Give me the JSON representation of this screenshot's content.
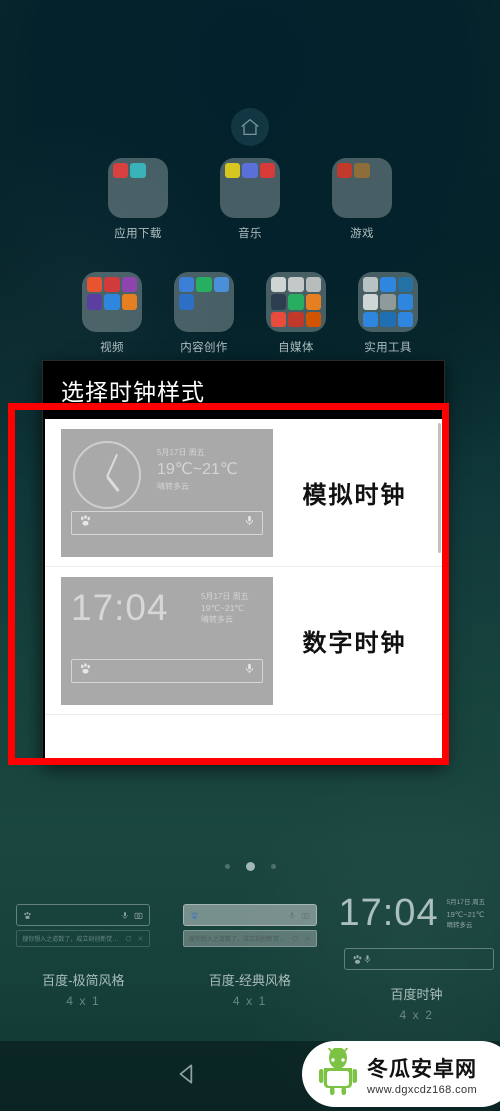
{
  "home": {
    "home_icon": "home-icon",
    "folder_rows": [
      [
        {
          "label": "应用下载",
          "colors": [
            "#d94040",
            "#39b3b8"
          ]
        },
        {
          "label": "音乐",
          "colors": [
            "#d7c520",
            "#5b6fd8",
            "#d83a3a"
          ]
        },
        {
          "label": "游戏",
          "colors": [
            "#c0392b",
            "#8d6e3a"
          ]
        }
      ],
      [
        {
          "label": "视频",
          "colors": [
            "#e8542f",
            "#d23b3b",
            "#8e44ad",
            "#5b3fa0",
            "#2e86de",
            "#e67e22"
          ]
        },
        {
          "label": "内容创作",
          "colors": [
            "#3b7fd6",
            "#27ae60",
            "#4a90d9",
            "#2d6fc4"
          ]
        },
        {
          "label": "自媒体",
          "colors": [
            "#bdc3c7",
            "#95a5a6",
            "#7f8c8d",
            "#2c3e50",
            "#27ae60",
            "#e67e22",
            "#e74c3c",
            "#c0392b",
            "#d35400"
          ]
        },
        {
          "label": "实用工具",
          "colors": [
            "#95a5a6",
            "#2e86de",
            "#2471a3",
            "#bdc3c7",
            "#7f8c8d",
            "#2e86de",
            "#2e86de",
            "#1f6fb2",
            "#2e86de"
          ]
        }
      ]
    ],
    "page_dots": {
      "count": 3,
      "active_index": 1
    }
  },
  "dialog": {
    "title": "选择时钟样式",
    "options": [
      {
        "name": "模拟时钟",
        "preview_type": "analog",
        "date": "5月17日 周五",
        "temperature": "19℃~21℃",
        "weather": "晴转多云",
        "search_left_icon": "baidu-paw-icon",
        "search_right_icon": "microphone-icon"
      },
      {
        "name": "数字时钟",
        "preview_type": "digital",
        "time": "17:04",
        "date": "5月17日 周五",
        "temperature": "19℃~21℃",
        "weather": "晴转多云",
        "search_left_icon": "baidu-paw-icon",
        "search_right_icon": "microphone-icon"
      }
    ]
  },
  "annotation": {
    "highlight_color": "#ff0000"
  },
  "widget_carousel": [
    {
      "label": "百度-极简风格",
      "size": "4 x 1",
      "type": "search-bar",
      "filled": false,
      "suggestion": "搜你想入之道数了，成立刻创新觉的...",
      "icons": [
        "baidu-paw-icon",
        "microphone-icon",
        "camera-icon",
        "refresh-icon",
        "close-icon"
      ]
    },
    {
      "label": "百度-经典风格",
      "size": "4 x 1",
      "type": "search-bar",
      "filled": true,
      "suggestion": "搜你想入之道数了，成立刻创新觉的...",
      "icons": [
        "baidu-paw-icon",
        "microphone-icon",
        "camera-icon",
        "refresh-icon",
        "close-icon"
      ]
    },
    {
      "label": "百度时钟",
      "size": "4 x 2",
      "type": "clock",
      "time": "17:04",
      "date": "5月17日 周五",
      "temperature": "19℃~21℃",
      "weather": "晴转多云",
      "icons": [
        "baidu-paw-icon",
        "microphone-icon"
      ]
    }
  ],
  "navbar": {
    "back": "back-triangle-icon",
    "home": "home-circle-icon"
  },
  "watermark": {
    "title": "冬瓜安卓网",
    "url": "www.dgxcdz168.com",
    "logo": "android-robot-icon"
  }
}
